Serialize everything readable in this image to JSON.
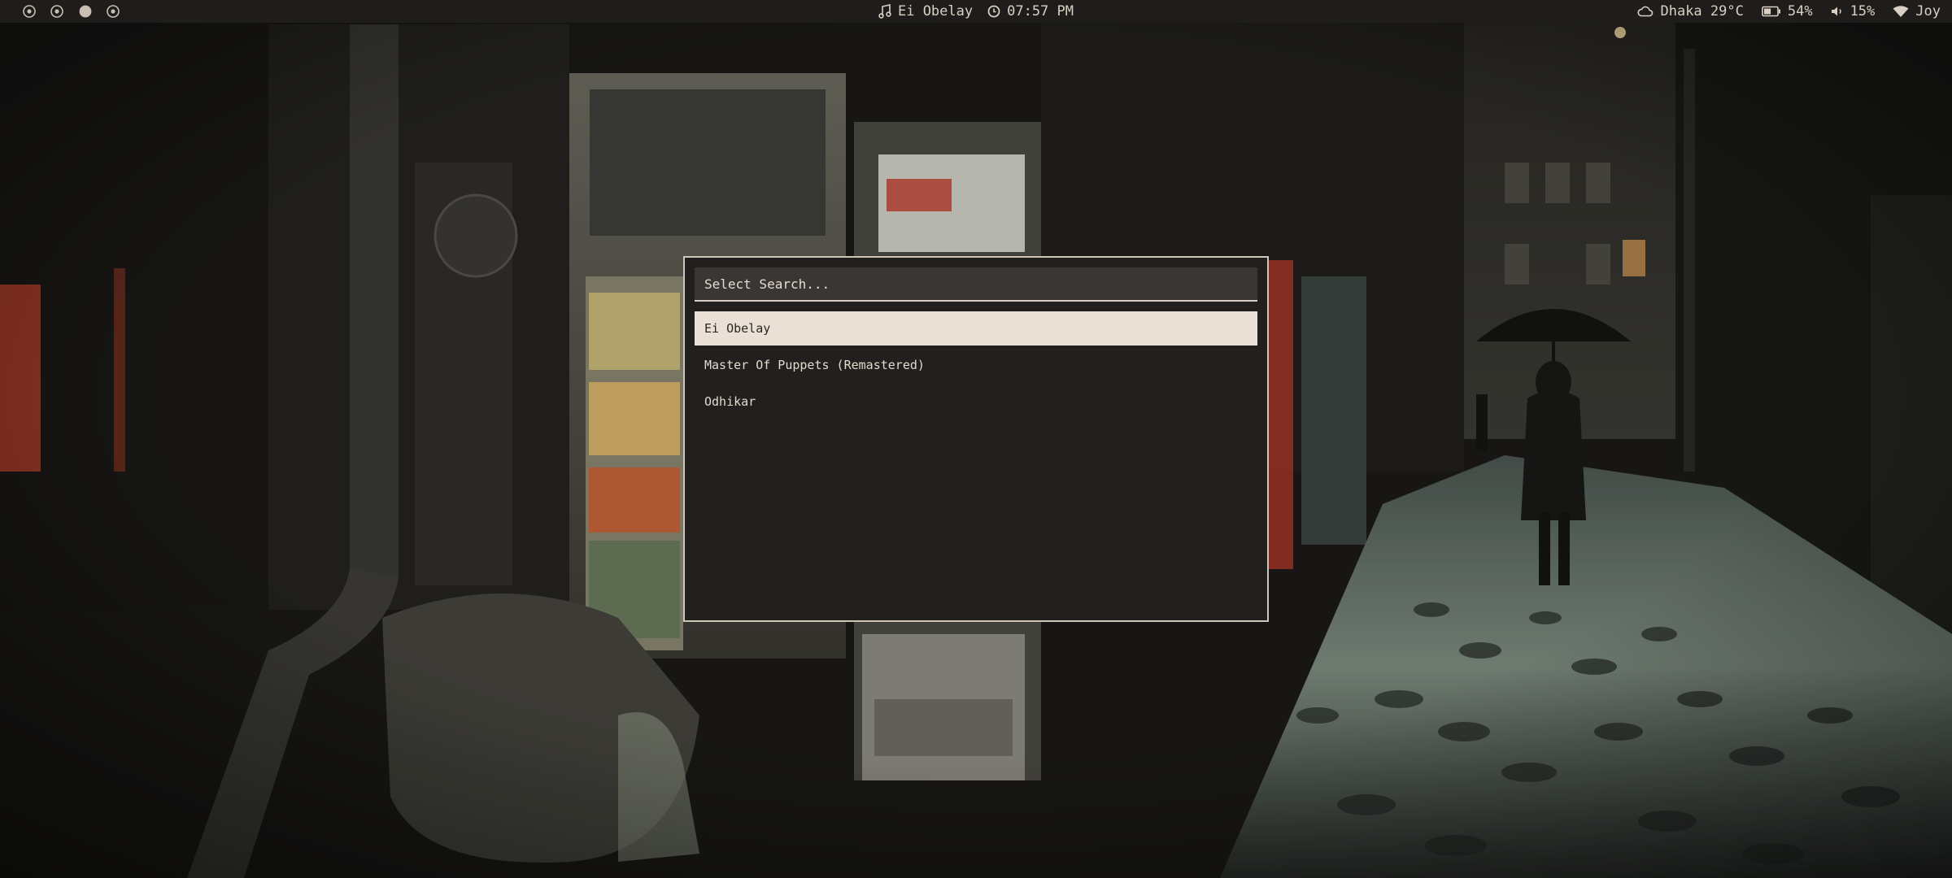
{
  "topbar": {
    "workspaces": [
      {
        "state": "inactive"
      },
      {
        "state": "inactive"
      },
      {
        "state": "active"
      },
      {
        "state": "inactive"
      }
    ],
    "now_playing": {
      "icon": "music-note-icon",
      "text": "Ei Obelay"
    },
    "clock": {
      "icon": "clock-icon",
      "text": "07:57 PM"
    },
    "weather": {
      "icon": "cloud-icon",
      "text": "Dhaka 29°C"
    },
    "battery": {
      "icon": "battery-icon",
      "text": "54%",
      "level": 0.54
    },
    "volume": {
      "icon": "speaker-icon",
      "text": "15%"
    },
    "network": {
      "icon": "wifi-icon",
      "text": "Joy"
    }
  },
  "launcher": {
    "search_placeholder": "Select Search...",
    "results": [
      {
        "label": "Ei Obelay",
        "selected": true
      },
      {
        "label": "Master Of Puppets (Remastered)",
        "selected": false
      },
      {
        "label": "Odhikar",
        "selected": false
      }
    ]
  },
  "colors": {
    "bar_bg": "#1e1d1b",
    "bar_text": "#d9cfc3",
    "launcher_bg": "#22201e",
    "launcher_border": "#cfc6ba",
    "search_bg": "#3a3633",
    "selected_bg": "#ebe0d6",
    "selected_text": "#2a2624",
    "item_text": "#e3d9cd"
  }
}
